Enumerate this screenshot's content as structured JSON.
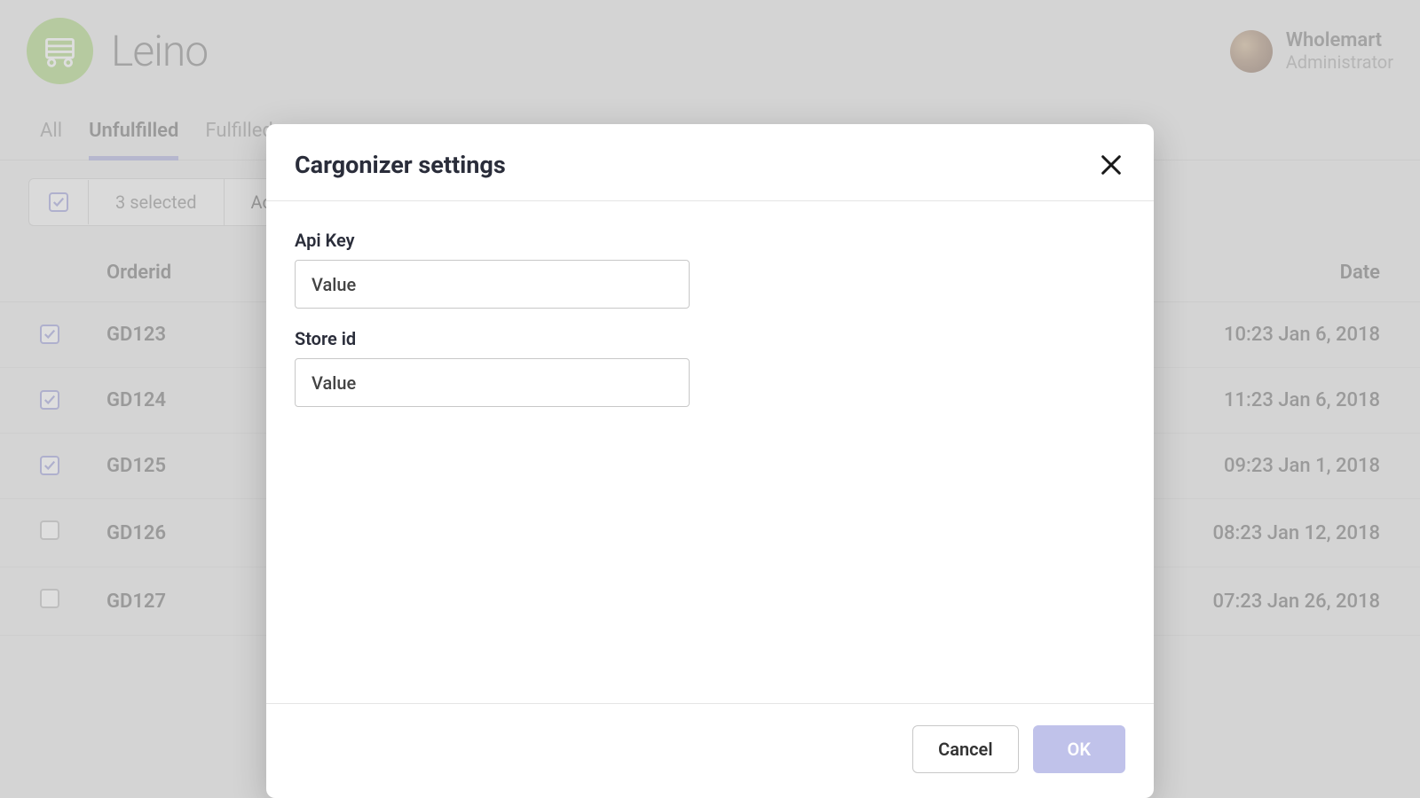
{
  "brand": {
    "name": "Leino"
  },
  "user": {
    "name": "Wholemart",
    "role": "Administrator"
  },
  "tabs": {
    "all": "All",
    "unfulfilled": "Unfulfilled",
    "fulfilled": "Fulfilled o"
  },
  "toolbar": {
    "selected_text": "3 selected",
    "actions_text": "Act"
  },
  "table": {
    "headers": {
      "orderid": "Orderid",
      "date": "Date"
    },
    "rows": [
      {
        "orderid": "GD123",
        "date": "10:23 Jan 6, 2018",
        "checked": true
      },
      {
        "orderid": "GD124",
        "date": "11:23 Jan 6, 2018",
        "checked": true
      },
      {
        "orderid": "GD125",
        "date": "09:23 Jan 1, 2018",
        "checked": true
      },
      {
        "orderid": "GD126",
        "date": "08:23 Jan 12, 2018",
        "checked": false
      },
      {
        "orderid": "GD127",
        "date": "07:23 Jan 26, 2018",
        "checked": false
      }
    ]
  },
  "modal": {
    "title": "Cargonizer settings",
    "fields": {
      "api_key": {
        "label": "Api Key",
        "placeholder": "Value"
      },
      "store_id": {
        "label": "Store id",
        "placeholder": "Value"
      }
    },
    "buttons": {
      "cancel": "Cancel",
      "ok": "OK"
    }
  }
}
